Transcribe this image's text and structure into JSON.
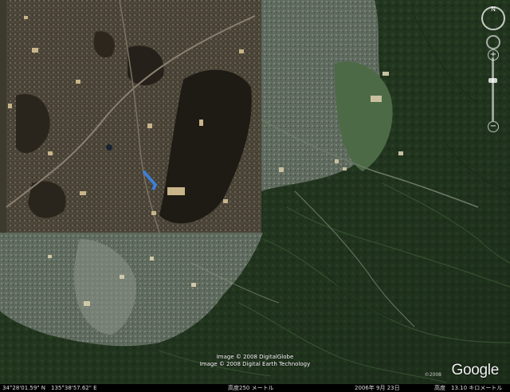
{
  "map": {
    "credits": [
      "Image © 2008 DigitalGlobe",
      "Image © 2008 Digital Earth Technology"
    ],
    "logo": "Google",
    "logo_mark": "©2008"
  },
  "status": {
    "latitude": "34°28'01.59\" N",
    "longitude": "135°38'57.62\" E",
    "elevation_label": "高度",
    "elevation_value": "250 メートル",
    "date": "2006年 9月 23日",
    "eye_label": "高度",
    "eye_value": "13.10 キロメートル"
  },
  "navigation": {
    "north_label": "N",
    "zoom_in": "+",
    "zoom_out": "−"
  }
}
